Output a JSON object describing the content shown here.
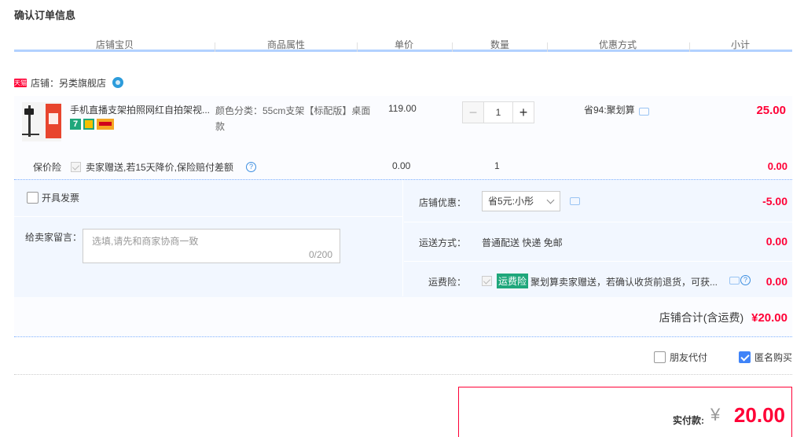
{
  "page_title": "确认订单信息",
  "columns": [
    "店铺宝贝",
    "商品属性",
    "单价",
    "数量",
    "优惠方式",
    "小计"
  ],
  "shop": {
    "logo_text": "天猫",
    "label": "店铺：另类旗舰店"
  },
  "item": {
    "title": "手机直播支架拍照网红自拍架视...",
    "badge_7": "7",
    "property": "颜色分类：55cm支架【标配版】桌面款",
    "unit_price": "119.00",
    "quantity": "1",
    "qty_minus": "−",
    "qty_plus": "+",
    "promo": "省94:聚划算",
    "subtotal": "25.00"
  },
  "insurance": {
    "label": "保价险",
    "description": "卖家赠送,若15天降价,保险赔付差额",
    "price": "0.00",
    "quantity": "1",
    "subtotal": "0.00"
  },
  "invoice": {
    "label": "开具发票"
  },
  "message": {
    "label": "给卖家留言：",
    "placeholder": "选填,请先和商家协商一致",
    "counter": "0/200"
  },
  "shop_discount": {
    "label": "店铺优惠：",
    "selected": "省5元:小彤",
    "amount": "-5.00"
  },
  "shipping": {
    "label": "运送方式：",
    "value": "普通配送 快递 免邮",
    "amount": "0.00"
  },
  "freight_insurance": {
    "label": "运费险：",
    "tag": "运费险",
    "description": "聚划算卖家赠送，若确认收货前退货，可获...",
    "amount": "0.00"
  },
  "shop_total": {
    "label": "店铺合计(含运费)",
    "amount": "¥20.00"
  },
  "options": {
    "friend_pay": "朋友代付",
    "anonymous": "匿名购买"
  },
  "payment": {
    "label": "实付款:",
    "currency": "¥",
    "amount": "20.00"
  },
  "colors": {
    "price_red": "#ff0036",
    "header_line": "#b2d1ff",
    "panel_bg": "#f2f7ff",
    "tag_green": "#1fa77b"
  }
}
